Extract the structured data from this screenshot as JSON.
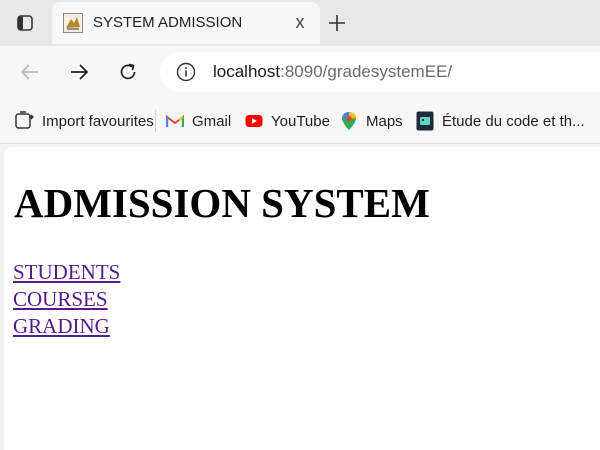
{
  "browser": {
    "tab": {
      "title": "SYSTEM ADMISSION",
      "close_label": "x"
    },
    "address": {
      "host": "localhost",
      "rest": ":8090/gradesystemEE/"
    },
    "bookmarks": [
      {
        "label": "Import favourites",
        "icon": "import-icon"
      },
      {
        "label": "Gmail",
        "icon": "gmail-icon"
      },
      {
        "label": "YouTube",
        "icon": "youtube-icon"
      },
      {
        "label": "Maps",
        "icon": "maps-icon"
      },
      {
        "label": "Étude du code et th...",
        "icon": "bookmark-favicon"
      }
    ]
  },
  "page": {
    "title": "ADMISSION SYSTEM",
    "links": [
      "STUDENTS",
      "COURSES",
      "GRADING"
    ]
  },
  "colors": {
    "visited_link": "#551a8b",
    "youtube": "#ff0000"
  }
}
